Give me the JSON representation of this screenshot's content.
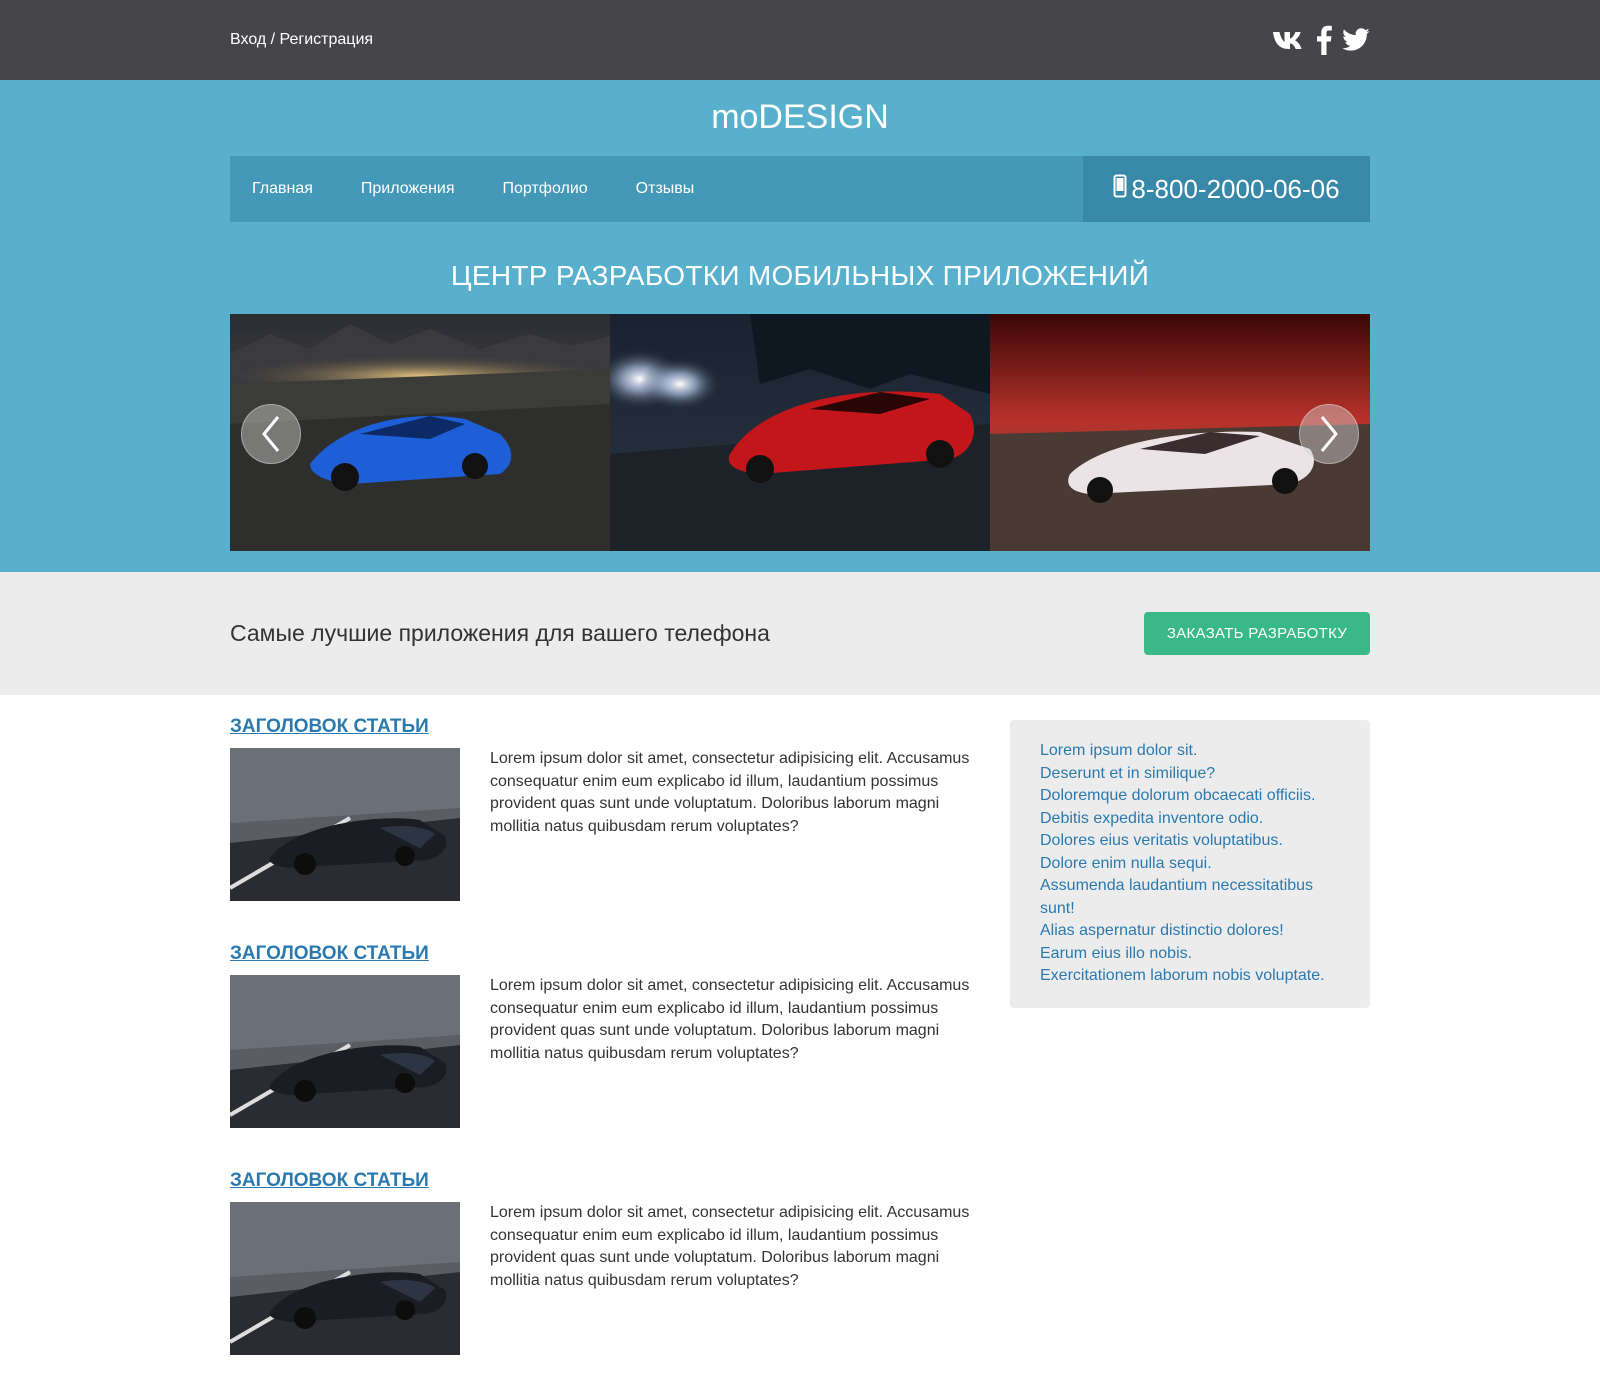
{
  "topbar": {
    "auth_label": "Вход / Регистрация",
    "social": [
      {
        "icon": "vk-icon",
        "label": "vk"
      },
      {
        "icon": "facebook-icon",
        "label": "f"
      },
      {
        "icon": "twitter-icon",
        "label": "twitter"
      }
    ]
  },
  "header": {
    "logo": "moDESIGN",
    "nav": [
      "Главная",
      "Приложения",
      "Портфолио",
      "Отзывы"
    ],
    "phone": "8-800-2000-06-06"
  },
  "hero": {
    "title": "ЦЕНТР РАЗРАБОТКИ МОБИЛЬНЫХ ПРИЛОЖЕНИЙ",
    "slides": [
      "blue sports car at night over city",
      "red sports car at night with headlights",
      "white sports car under red sky"
    ]
  },
  "cta": {
    "text": "Самые лучшие приложения для вашего телефона",
    "button": "ЗАКАЗАТЬ РАЗРАБОТКУ"
  },
  "articles": [
    {
      "title": "ЗАГОЛОВОК СТАТЬИ",
      "text": "Lorem ipsum dolor sit amet, consectetur adipisicing elit. Accusamus consequatur enim eum explicabo id illum, laudantium possimus provident quas sunt unde voluptatum. Doloribus laborum magni mollitia natus quibusdam rerum voluptates?"
    },
    {
      "title": "ЗАГОЛОВОК СТАТЬИ",
      "text": "Lorem ipsum dolor sit amet, consectetur adipisicing elit. Accusamus consequatur enim eum explicabo id illum, laudantium possimus provident quas sunt unde voluptatum. Doloribus laborum magni mollitia natus quibusdam rerum voluptates?"
    },
    {
      "title": "ЗАГОЛОВОК СТАТЬИ",
      "text": "Lorem ipsum dolor sit amet, consectetur adipisicing elit. Accusamus consequatur enim eum explicabo id illum, laudantium possimus provident quas sunt unde voluptatum. Doloribus laborum magni mollitia natus quibusdam rerum voluptates?"
    }
  ],
  "sidebar": {
    "links": [
      "Lorem ipsum dolor sit.",
      "Deserunt et in similique?",
      "Doloremque dolorum obcaecati officiis.",
      "Debitis expedita inventore odio.",
      "Dolores eius veritatis voluptatibus.",
      "Dolore enim nulla sequi.",
      "Assumenda laudantium necessitatibus sunt!",
      "Alias aspernatur distinctio dolores!",
      "Earum eius illo nobis.",
      "Exercitationem laborum nobis voluptate."
    ]
  },
  "colors": {
    "topbar": "#46464a",
    "hero": "#59b0cc",
    "nav": "#4499b8",
    "phone_box": "#3889a7",
    "cta_button": "#39b98a",
    "link": "#2a7ab0",
    "band": "#ececec"
  }
}
